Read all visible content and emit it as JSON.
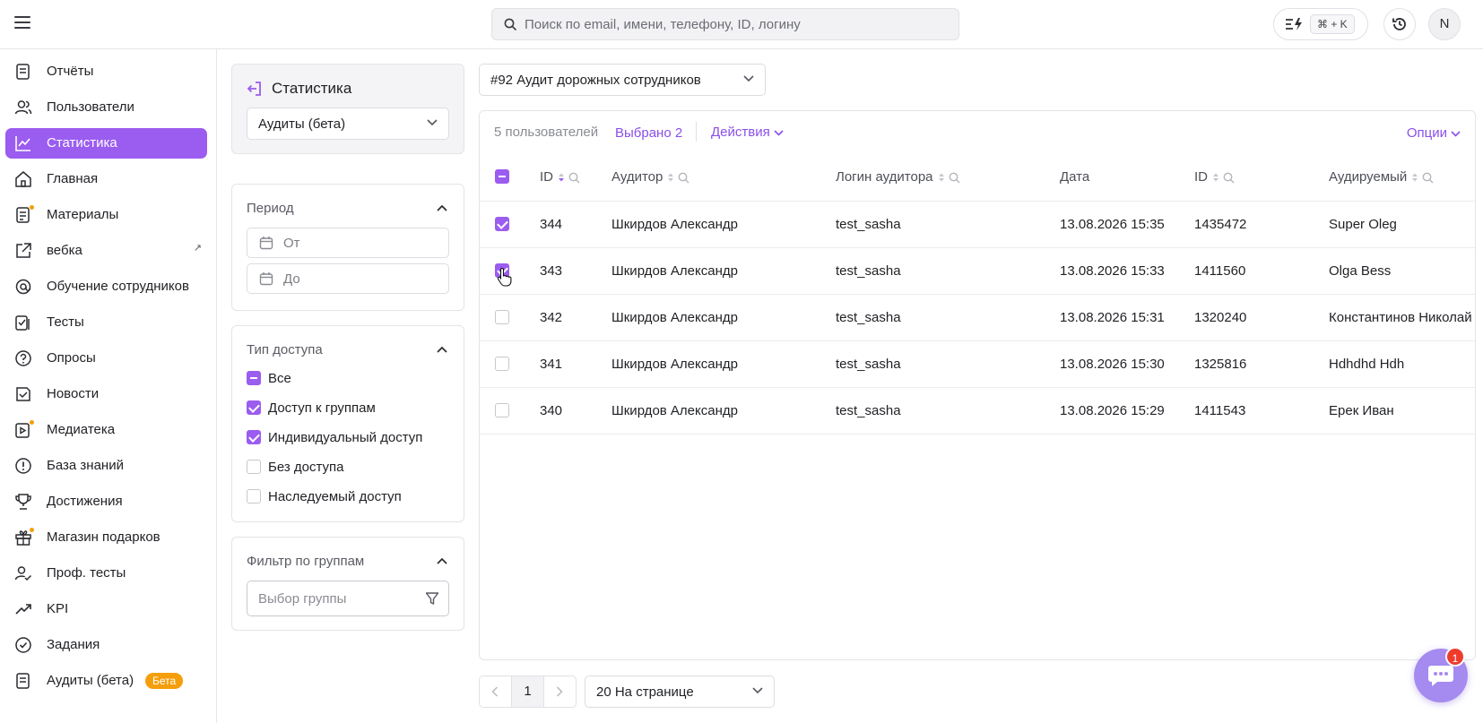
{
  "header": {
    "search_placeholder": "Поиск по email, имени, телефону, ID, логину",
    "shortcut": "⌘ + K",
    "avatar_initial": "N"
  },
  "sidebar": {
    "items": [
      {
        "label": "Отчёты",
        "icon": "report-icon"
      },
      {
        "label": "Пользователи",
        "icon": "users-icon"
      },
      {
        "label": "Статистика",
        "icon": "chart-line-icon",
        "active": true
      },
      {
        "label": "Главная",
        "icon": "home-icon"
      },
      {
        "label": "Материалы",
        "icon": "materials-icon",
        "dot": true
      },
      {
        "label": "вебка",
        "icon": "external-link-icon",
        "external": "↗"
      },
      {
        "label": "Обучение сотрудников",
        "icon": "training-icon"
      },
      {
        "label": "Тесты",
        "icon": "tests-icon"
      },
      {
        "label": "Опросы",
        "icon": "survey-icon"
      },
      {
        "label": "Новости",
        "icon": "news-icon"
      },
      {
        "label": "Медиатека",
        "icon": "media-icon",
        "dot": true
      },
      {
        "label": "База знаний",
        "icon": "knowledge-icon"
      },
      {
        "label": "Достижения",
        "icon": "trophy-icon"
      },
      {
        "label": "Магазин подарков",
        "icon": "gift-icon",
        "dot": true
      },
      {
        "label": "Проф. тесты",
        "icon": "prof-tests-icon"
      },
      {
        "label": "KPI",
        "icon": "trend-icon"
      },
      {
        "label": "Задания",
        "icon": "tasks-icon"
      },
      {
        "label": "Аудиты (бета)",
        "icon": "audit-icon",
        "badge": "Бета"
      }
    ]
  },
  "filters": {
    "title": "Статистика",
    "report_type": "Аудиты (бета)",
    "period": {
      "label": "Период",
      "from_placeholder": "От",
      "to_placeholder": "До"
    },
    "access": {
      "label": "Тип доступа",
      "options": [
        {
          "label": "Все",
          "state": "indeterminate"
        },
        {
          "label": "Доступ к группам",
          "state": "checked"
        },
        {
          "label": "Индивидуальный доступ",
          "state": "checked"
        },
        {
          "label": "Без доступа",
          "state": "unchecked"
        },
        {
          "label": "Наследуемый доступ",
          "state": "unchecked"
        }
      ]
    },
    "groups": {
      "label": "Фильтр по группам",
      "placeholder": "Выбор группы"
    }
  },
  "main": {
    "audit_select": "#92 Аудит дорожных сотрудников",
    "count": "5 пользователей",
    "selected": "Выбрано 2",
    "actions": "Действия",
    "options": "Опции",
    "columns": [
      "ID",
      "Аудитор",
      "Логин аудитора",
      "Дата",
      "ID",
      "Аудируемый"
    ],
    "rows": [
      {
        "checked": true,
        "id": "344",
        "auditor": "Шкирдов Александр",
        "login": "test_sasha",
        "date": "13.08.2026 15:35",
        "id2": "1435472",
        "audited": "Super Oleg"
      },
      {
        "checked": true,
        "id": "343",
        "auditor": "Шкирдов Александр",
        "login": "test_sasha",
        "date": "13.08.2026 15:33",
        "id2": "1411560",
        "audited": "Olga Bess"
      },
      {
        "checked": false,
        "id": "342",
        "auditor": "Шкирдов Александр",
        "login": "test_sasha",
        "date": "13.08.2026 15:31",
        "id2": "1320240",
        "audited": "Константинов Николай"
      },
      {
        "checked": false,
        "id": "341",
        "auditor": "Шкирдов Александр",
        "login": "test_sasha",
        "date": "13.08.2026 15:30",
        "id2": "1325816",
        "audited": "Hdhdhd Hdh"
      },
      {
        "checked": false,
        "id": "340",
        "auditor": "Шкирдов Александр",
        "login": "test_sasha",
        "date": "13.08.2026 15:29",
        "id2": "1411543",
        "audited": "Ерек Иван"
      }
    ],
    "pagination": {
      "page": "1",
      "per_page": "20 На странице"
    }
  },
  "chat": {
    "badge": "1"
  },
  "colors": {
    "accent": "#9b5cf0",
    "badge": "#f59e0b",
    "notification": "#ef3b2d"
  }
}
